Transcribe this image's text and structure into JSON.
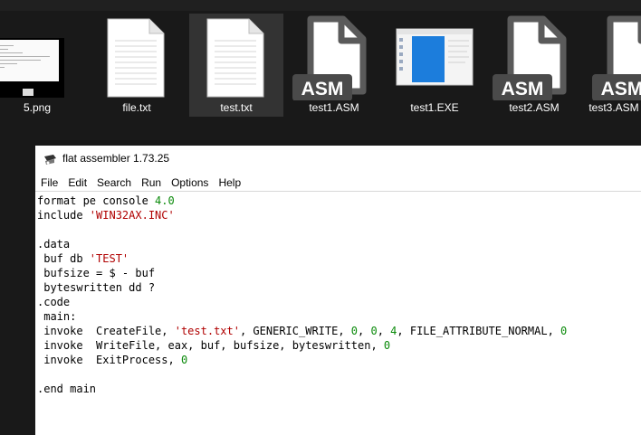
{
  "explorer": {
    "files": [
      {
        "name": "5.png",
        "icon": "image-thumbnail-icon",
        "selected": false
      },
      {
        "name": "file.txt",
        "icon": "text-file-icon",
        "selected": false
      },
      {
        "name": "test.txt",
        "icon": "text-file-icon",
        "selected": true
      },
      {
        "name": "test1.ASM",
        "icon": "asm-file-icon",
        "badge": "ASM",
        "selected": false
      },
      {
        "name": "test1.EXE",
        "icon": "exe-file-icon",
        "selected": false
      },
      {
        "name": "test2.ASM",
        "icon": "asm-file-icon",
        "badge": "ASM",
        "selected": false
      },
      {
        "name": "test3.ASM",
        "icon": "asm-file-icon",
        "badge": "ASM",
        "selected": false
      }
    ]
  },
  "editor": {
    "title": "flat assembler 1.73.25",
    "menu": [
      "File",
      "Edit",
      "Search",
      "Run",
      "Options",
      "Help"
    ],
    "code_lines": [
      [
        {
          "t": "format pe console "
        },
        {
          "t": "4.0",
          "c": "num"
        }
      ],
      [
        {
          "t": "include "
        },
        {
          "t": "'WIN32AX.INC'",
          "c": "str"
        }
      ],
      [
        {
          "t": ""
        }
      ],
      [
        {
          "t": ".data"
        }
      ],
      [
        {
          "t": " buf db "
        },
        {
          "t": "'TEST'",
          "c": "str"
        }
      ],
      [
        {
          "t": " bufsize = $ - buf"
        }
      ],
      [
        {
          "t": " byteswritten dd ?"
        }
      ],
      [
        {
          "t": ".code"
        }
      ],
      [
        {
          "t": " main:"
        }
      ],
      [
        {
          "t": " invoke  CreateFile, "
        },
        {
          "t": "'test.txt'",
          "c": "str"
        },
        {
          "t": ", GENERIC_WRITE, "
        },
        {
          "t": "0",
          "c": "num"
        },
        {
          "t": ", "
        },
        {
          "t": "0",
          "c": "num"
        },
        {
          "t": ", "
        },
        {
          "t": "4",
          "c": "num"
        },
        {
          "t": ", FILE_ATTRIBUTE_NORMAL, "
        },
        {
          "t": "0",
          "c": "num"
        }
      ],
      [
        {
          "t": " invoke  WriteFile, eax, buf, bufsize, byteswritten, "
        },
        {
          "t": "0",
          "c": "num"
        }
      ],
      [
        {
          "t": " invoke  ExitProcess, "
        },
        {
          "t": "0",
          "c": "num"
        }
      ],
      [
        {
          "t": ""
        }
      ],
      [
        {
          "t": ".end main"
        }
      ]
    ]
  },
  "colors": {
    "explorer_bg": "#191919",
    "selected_bg": "#333333",
    "number": "#0a8a0a",
    "string": "#b00000"
  }
}
